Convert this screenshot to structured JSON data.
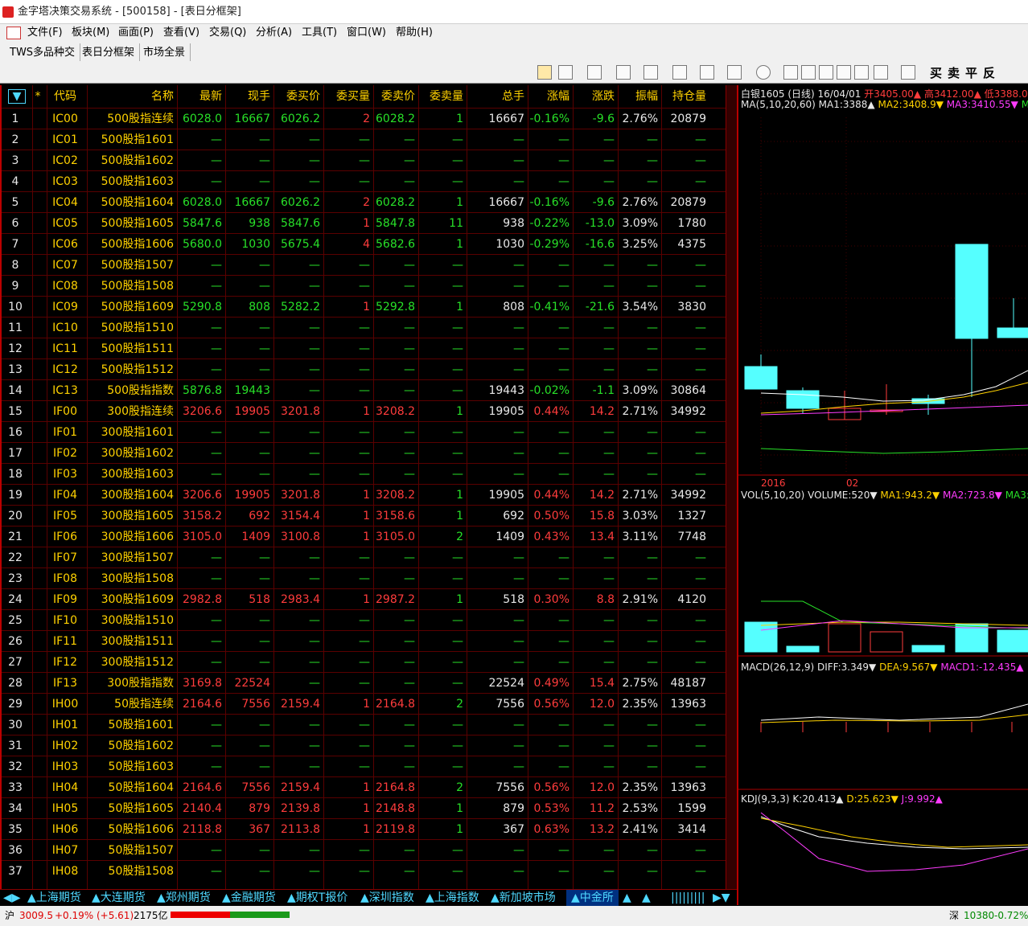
{
  "title": "金字塔决策交易系统 - [500158] - [表日分框架]",
  "menu": [
    "文件(F)",
    "板块(M)",
    "画面(P)",
    "查看(V)",
    "交易(Q)",
    "分析(A)",
    "工具(T)",
    "窗口(W)",
    "帮助(H)"
  ],
  "window_tabs": [
    "TWS多品种交",
    "表日分框架",
    "市场全景"
  ],
  "toolbar_text": [
    "买",
    "卖",
    "平",
    "反"
  ],
  "headers": [
    "*",
    "代码",
    "名称",
    "最新",
    "现手",
    "委买价",
    "委买量",
    "委卖价",
    "委卖量",
    "总手",
    "涨幅",
    "涨跌",
    "振幅",
    "持仓量"
  ],
  "rows": [
    [
      "1",
      "IC00",
      "500股指连续",
      "6028.0",
      "16667",
      "6026.2",
      "2",
      "6028.2",
      "1",
      "16667",
      "-0.16%",
      "-9.6",
      "2.76%",
      "20879"
    ],
    [
      "2",
      "IC01",
      "500股指1601",
      "—",
      "—",
      "—",
      "—",
      "—",
      "—",
      "—",
      "—",
      "—",
      "—",
      "—"
    ],
    [
      "3",
      "IC02",
      "500股指1602",
      "—",
      "—",
      "—",
      "—",
      "—",
      "—",
      "—",
      "—",
      "—",
      "—",
      "—"
    ],
    [
      "4",
      "IC03",
      "500股指1603",
      "—",
      "—",
      "—",
      "—",
      "—",
      "—",
      "—",
      "—",
      "—",
      "—",
      "—"
    ],
    [
      "5",
      "IC04",
      "500股指1604",
      "6028.0",
      "16667",
      "6026.2",
      "2",
      "6028.2",
      "1",
      "16667",
      "-0.16%",
      "-9.6",
      "2.76%",
      "20879"
    ],
    [
      "6",
      "IC05",
      "500股指1605",
      "5847.6",
      "938",
      "5847.6",
      "1",
      "5847.8",
      "11",
      "938",
      "-0.22%",
      "-13.0",
      "3.09%",
      "1780"
    ],
    [
      "7",
      "IC06",
      "500股指1606",
      "5680.0",
      "1030",
      "5675.4",
      "4",
      "5682.6",
      "1",
      "1030",
      "-0.29%",
      "-16.6",
      "3.25%",
      "4375"
    ],
    [
      "8",
      "IC07",
      "500股指1507",
      "—",
      "—",
      "—",
      "—",
      "—",
      "—",
      "—",
      "—",
      "—",
      "—",
      "—"
    ],
    [
      "9",
      "IC08",
      "500股指1508",
      "—",
      "—",
      "—",
      "—",
      "—",
      "—",
      "—",
      "—",
      "—",
      "—",
      "—"
    ],
    [
      "10",
      "IC09",
      "500股指1609",
      "5290.8",
      "808",
      "5282.2",
      "1",
      "5292.8",
      "1",
      "808",
      "-0.41%",
      "-21.6",
      "3.54%",
      "3830"
    ],
    [
      "11",
      "IC10",
      "500股指1510",
      "—",
      "—",
      "—",
      "—",
      "—",
      "—",
      "—",
      "—",
      "—",
      "—",
      "—"
    ],
    [
      "12",
      "IC11",
      "500股指1511",
      "—",
      "—",
      "—",
      "—",
      "—",
      "—",
      "—",
      "—",
      "—",
      "—",
      "—"
    ],
    [
      "13",
      "IC12",
      "500股指1512",
      "—",
      "—",
      "—",
      "—",
      "—",
      "—",
      "—",
      "—",
      "—",
      "—",
      "—"
    ],
    [
      "14",
      "IC13",
      "500股指指数",
      "5876.8",
      "19443",
      "—",
      "—",
      "—",
      "—",
      "19443",
      "-0.02%",
      "-1.1",
      "3.09%",
      "30864"
    ],
    [
      "15",
      "IF00",
      "300股指连续",
      "3206.6",
      "19905",
      "3201.8",
      "1",
      "3208.2",
      "1",
      "19905",
      "0.44%",
      "14.2",
      "2.71%",
      "34992"
    ],
    [
      "16",
      "IF01",
      "300股指1601",
      "—",
      "—",
      "—",
      "—",
      "—",
      "—",
      "—",
      "—",
      "—",
      "—",
      "—"
    ],
    [
      "17",
      "IF02",
      "300股指1602",
      "—",
      "—",
      "—",
      "—",
      "—",
      "—",
      "—",
      "—",
      "—",
      "—",
      "—"
    ],
    [
      "18",
      "IF03",
      "300股指1603",
      "—",
      "—",
      "—",
      "—",
      "—",
      "—",
      "—",
      "—",
      "—",
      "—",
      "—"
    ],
    [
      "19",
      "IF04",
      "300股指1604",
      "3206.6",
      "19905",
      "3201.8",
      "1",
      "3208.2",
      "1",
      "19905",
      "0.44%",
      "14.2",
      "2.71%",
      "34992"
    ],
    [
      "20",
      "IF05",
      "300股指1605",
      "3158.2",
      "692",
      "3154.4",
      "1",
      "3158.6",
      "1",
      "692",
      "0.50%",
      "15.8",
      "3.03%",
      "1327"
    ],
    [
      "21",
      "IF06",
      "300股指1606",
      "3105.0",
      "1409",
      "3100.8",
      "1",
      "3105.0",
      "2",
      "1409",
      "0.43%",
      "13.4",
      "3.11%",
      "7748"
    ],
    [
      "22",
      "IF07",
      "300股指1507",
      "—",
      "—",
      "—",
      "—",
      "—",
      "—",
      "—",
      "—",
      "—",
      "—",
      "—"
    ],
    [
      "23",
      "IF08",
      "300股指1508",
      "—",
      "—",
      "—",
      "—",
      "—",
      "—",
      "—",
      "—",
      "—",
      "—",
      "—"
    ],
    [
      "24",
      "IF09",
      "300股指1609",
      "2982.8",
      "518",
      "2983.4",
      "1",
      "2987.2",
      "1",
      "518",
      "0.30%",
      "8.8",
      "2.91%",
      "4120"
    ],
    [
      "25",
      "IF10",
      "300股指1510",
      "—",
      "—",
      "—",
      "—",
      "—",
      "—",
      "—",
      "—",
      "—",
      "—",
      "—"
    ],
    [
      "26",
      "IF11",
      "300股指1511",
      "—",
      "—",
      "—",
      "—",
      "—",
      "—",
      "—",
      "—",
      "—",
      "—",
      "—"
    ],
    [
      "27",
      "IF12",
      "300股指1512",
      "—",
      "—",
      "—",
      "—",
      "—",
      "—",
      "—",
      "—",
      "—",
      "—",
      "—"
    ],
    [
      "28",
      "IF13",
      "300股指指数",
      "3169.8",
      "22524",
      "—",
      "—",
      "—",
      "—",
      "22524",
      "0.49%",
      "15.4",
      "2.75%",
      "48187"
    ],
    [
      "29",
      "IH00",
      "50股指连续",
      "2164.6",
      "7556",
      "2159.4",
      "1",
      "2164.8",
      "2",
      "7556",
      "0.56%",
      "12.0",
      "2.35%",
      "13963"
    ],
    [
      "30",
      "IH01",
      "50股指1601",
      "—",
      "—",
      "—",
      "—",
      "—",
      "—",
      "—",
      "—",
      "—",
      "—",
      "—"
    ],
    [
      "31",
      "IH02",
      "50股指1602",
      "—",
      "—",
      "—",
      "—",
      "—",
      "—",
      "—",
      "—",
      "—",
      "—",
      "—"
    ],
    [
      "32",
      "IH03",
      "50股指1603",
      "—",
      "—",
      "—",
      "—",
      "—",
      "—",
      "—",
      "—",
      "—",
      "—",
      "—"
    ],
    [
      "33",
      "IH04",
      "50股指1604",
      "2164.6",
      "7556",
      "2159.4",
      "1",
      "2164.8",
      "2",
      "7556",
      "0.56%",
      "12.0",
      "2.35%",
      "13963"
    ],
    [
      "34",
      "IH05",
      "50股指1605",
      "2140.4",
      "879",
      "2139.8",
      "1",
      "2148.8",
      "1",
      "879",
      "0.53%",
      "11.2",
      "2.53%",
      "1599"
    ],
    [
      "35",
      "IH06",
      "50股指1606",
      "2118.8",
      "367",
      "2113.8",
      "1",
      "2119.8",
      "1",
      "367",
      "0.63%",
      "13.2",
      "2.41%",
      "3414"
    ],
    [
      "36",
      "IH07",
      "50股指1507",
      "—",
      "—",
      "—",
      "—",
      "—",
      "—",
      "—",
      "—",
      "—",
      "—",
      "—"
    ],
    [
      "37",
      "IH08",
      "50股指1508",
      "—",
      "—",
      "—",
      "—",
      "—",
      "—",
      "—",
      "—",
      "—",
      "—",
      "—"
    ]
  ],
  "bottom_tabs": [
    "上海期货",
    "大连期货",
    "郑州期货",
    "金融期货",
    "期权T报价",
    "深圳指数",
    "上海指数",
    "新加坡市场",
    "中金所"
  ],
  "chart": {
    "title": "白银1605 (日线) 16/04/01",
    "open": "开3405.00▲",
    "high": "高3412.00▲",
    "low": "低3388.00▲",
    "close_lbl": "收",
    "ma": "MA(5,10,20,60)",
    "ma1": "MA1:3388▲",
    "ma2": "MA2:3408.9▼",
    "ma3": "MA3:3410.55▼",
    "ma4": "MA4:3",
    "x1": "2016",
    "x2": "02",
    "vol": "VOL(5,10,20)",
    "volume": "VOLUME:520▼",
    "vma1": "MA1:943.2▼",
    "vma2": "MA2:723.8▼",
    "vma3": "MA3:755.",
    "macd": "MACD(26,12,9)",
    "diff": "DIFF:3.349▼",
    "dea": "DEA:9.567▼",
    "macd1": "MACD1:-12.435▲",
    "kdj": "KDJ(9,3,3)",
    "k": "K:20.413▲",
    "d": "D:25.623▼",
    "j": "J:9.992▲"
  },
  "status": {
    "sh_label": "沪",
    "sh_val": "3009.5",
    "sh_chg": "+0.19% (+5.61)",
    "sh_amt": "2175亿",
    "sz_label": "深",
    "sz_val": "10380",
    "sz_chg": "-0.72%"
  }
}
